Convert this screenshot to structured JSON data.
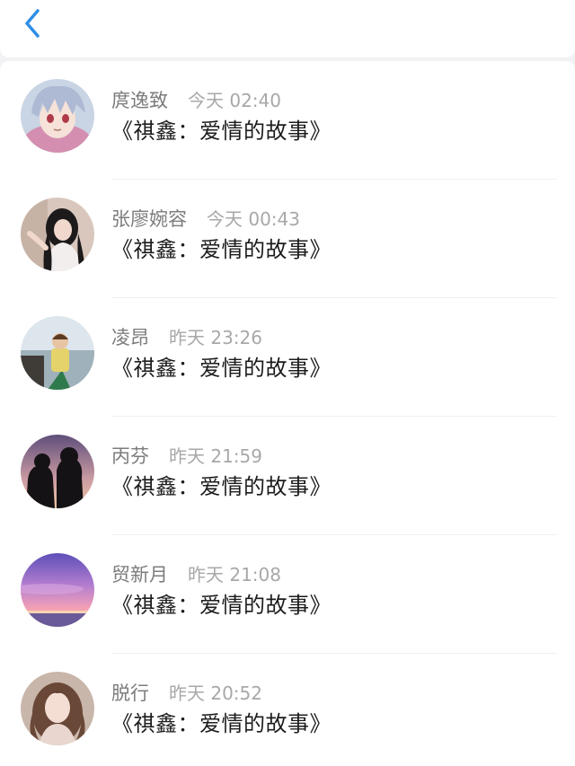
{
  "nav": {
    "back_icon": "chevron-left-icon",
    "accent_color": "#2f8fe6"
  },
  "list": {
    "items": [
      {
        "name": "庹逸致",
        "time": "今天 02:40",
        "message": "《祺鑫：爱情的故事》",
        "avatar": "anime-boy-silver-hair-avatar"
      },
      {
        "name": "张廖婉容",
        "time": "今天 00:43",
        "message": "《祺鑫：爱情的故事》",
        "avatar": "girl-long-black-hair-avatar"
      },
      {
        "name": "凌昂",
        "time": "昨天 23:26",
        "message": "《祺鑫：爱情的故事》",
        "avatar": "child-by-sea-avatar"
      },
      {
        "name": "丙芬",
        "time": "昨天 21:59",
        "message": "《祺鑫：爱情的故事》",
        "avatar": "couple-silhouette-sunset-avatar"
      },
      {
        "name": "贸新月",
        "time": "昨天 21:08",
        "message": "《祺鑫：爱情的故事》",
        "avatar": "purple-sunset-sky-avatar"
      },
      {
        "name": "脱行",
        "time": "昨天 20:52",
        "message": "《祺鑫：爱情的故事》",
        "avatar": "girl-curly-hair-avatar"
      }
    ]
  }
}
